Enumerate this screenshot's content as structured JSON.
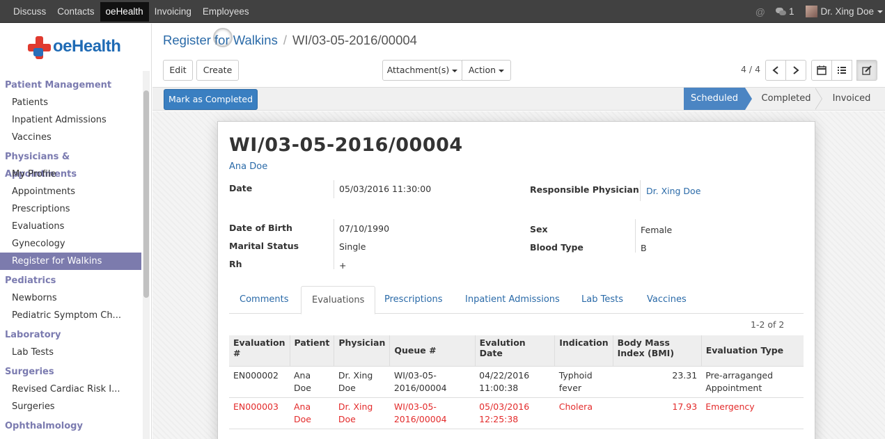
{
  "topbar": {
    "menu": [
      "Discuss",
      "Contacts",
      "oeHealth",
      "Invoicing",
      "Employees"
    ],
    "active_menu": "oeHealth",
    "at_symbol": "@",
    "notifications_count": "1",
    "user_name": "Dr. Xing Doe"
  },
  "logo": {
    "text": "oeHealth"
  },
  "sidebar": {
    "sections": [
      {
        "title": "Patient Management",
        "items": [
          "Patients",
          "Inpatient Admissions",
          "Vaccines"
        ]
      },
      {
        "title": "Physicians & Appointments",
        "items": [
          "My Profile",
          "Appointments",
          "Prescriptions",
          "Evaluations",
          "Gynecology",
          "Register for Walkins"
        ]
      },
      {
        "title": "Pediatrics",
        "items": [
          "Newborns",
          "Pediatric Symptom Ch..."
        ]
      },
      {
        "title": "Laboratory",
        "items": [
          "Lab Tests"
        ]
      },
      {
        "title": "Surgeries",
        "items": [
          "Revised Cardiac Risk I...",
          "Surgeries"
        ]
      },
      {
        "title": "Ophthalmology",
        "items": []
      }
    ],
    "active_item": "Register for Walkins"
  },
  "breadcrumb": {
    "parent": "Register for Walkins",
    "separator": "/",
    "current": "WI/03-05-2016/00004"
  },
  "toolbar": {
    "edit_label": "Edit",
    "create_label": "Create",
    "attachments_label": "Attachment(s)",
    "action_label": "Action",
    "pager": "4 / 4"
  },
  "statusbar": {
    "button_label": "Mark as Completed",
    "stages": [
      "Scheduled",
      "Completed",
      "Invoiced"
    ],
    "active_stage": "Scheduled"
  },
  "record": {
    "title": "WI/03-05-2016/00004",
    "patient": "Ana Doe",
    "fields": {
      "date_label": "Date",
      "date_value": "05/03/2016 11:30:00",
      "physician_label": "Responsible Physician",
      "physician_value": "Dr. Xing Doe",
      "dob_label": "Date of Birth",
      "dob_value": "07/10/1990",
      "marital_label": "Marital Status",
      "marital_value": "Single",
      "rh_label": "Rh",
      "rh_value": "+",
      "sex_label": "Sex",
      "sex_value": "Female",
      "blood_label": "Blood Type",
      "blood_value": "B"
    }
  },
  "tabs": [
    "Comments",
    "Evaluations",
    "Prescriptions",
    "Inpatient Admissions",
    "Lab Tests",
    "Vaccines"
  ],
  "active_tab": "Evaluations",
  "list": {
    "count": "1-2 of 2",
    "headers": {
      "evaluation": "Evaluation #",
      "patient": "Patient",
      "physician": "Physician",
      "queue": "Queue #",
      "date": "Evalution Date",
      "indication": "Indication",
      "bmi": "Body Mass Index (BMI)",
      "type": "Evaluation Type"
    },
    "rows": [
      {
        "evaluation": "EN000002",
        "patient": "Ana Doe",
        "physician": "Dr. Xing Doe",
        "queue": "WI/03-05-2016/00004",
        "date": "04/22/2016 11:00:38",
        "indication": "Typhoid fever",
        "bmi": "23.31",
        "type": "Pre-arraganged Appointment",
        "highlight": false
      },
      {
        "evaluation": "EN000003",
        "patient": "Ana Doe",
        "physician": "Dr. Xing Doe",
        "queue": "WI/03-05-2016/00004",
        "date": "05/03/2016 12:25:38",
        "indication": "Cholera",
        "bmi": "17.93",
        "type": "Emergency",
        "highlight": true
      }
    ]
  },
  "colors": {
    "topbar": "#414141",
    "link": "#2a6aa8",
    "sidebar_active": "#7c7bad",
    "section_header": "#7b7bb0",
    "primary_button": "#3a7fc1",
    "active_stage": "#4b85c3",
    "overdue_row": "#e32b2b"
  }
}
